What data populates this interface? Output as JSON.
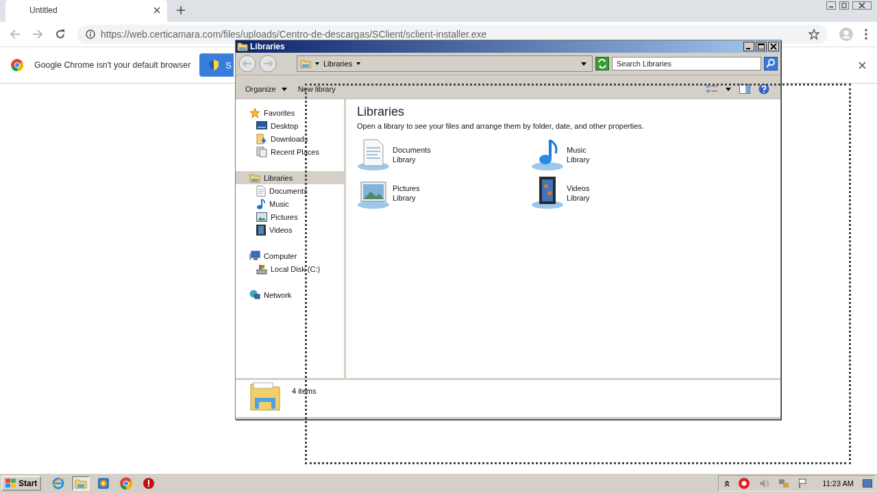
{
  "browser": {
    "tab": {
      "title": "Untitled"
    },
    "url": "https://web.certicamara.com/files/uploads/Centro-de-descargas/SClient/sclient-installer.exe",
    "infobar": {
      "message": "Google Chrome isn't your default browser",
      "button": "S"
    }
  },
  "explorer": {
    "title": "Libraries",
    "breadcrumb": "Libraries",
    "search": {
      "placeholder": "Search Libraries"
    },
    "toolbar": [
      {
        "label": "Organize",
        "menu": true
      },
      {
        "label": "New library",
        "menu": false
      }
    ],
    "nav": [
      {
        "label": "Favorites",
        "kind": "star",
        "selected": false,
        "children": [
          {
            "label": "Desktop",
            "kind": "desktop",
            "selected": false
          },
          {
            "label": "Downloads",
            "kind": "downloads",
            "selected": false
          },
          {
            "label": "Recent Places",
            "kind": "recent",
            "selected": false
          }
        ]
      },
      {
        "label": "Libraries",
        "kind": "library",
        "selected": true,
        "children": [
          {
            "label": "Documents",
            "kind": "documents",
            "selected": false
          },
          {
            "label": "Music",
            "kind": "music",
            "selected": false
          },
          {
            "label": "Pictures",
            "kind": "pictures",
            "selected": false
          },
          {
            "label": "Videos",
            "kind": "videos",
            "selected": false
          }
        ]
      },
      {
        "label": "Computer",
        "kind": "computer",
        "selected": false,
        "children": [
          {
            "label": "Local Disk (C:)",
            "kind": "disk",
            "selected": false
          }
        ]
      },
      {
        "label": "Network",
        "kind": "network",
        "selected": false
      }
    ],
    "heading": "Libraries",
    "description": "Open a library to see your files and arrange them by folder, date, and other properties.",
    "libraries": [
      {
        "name": "Documents",
        "type": "Library",
        "kind": "documents"
      },
      {
        "name": "Music",
        "type": "Library",
        "kind": "music"
      },
      {
        "name": "Pictures",
        "type": "Library",
        "kind": "pictures"
      },
      {
        "name": "Videos",
        "type": "Library",
        "kind": "videos"
      }
    ],
    "status": "4 items"
  },
  "taskbar": {
    "start": "Start",
    "apps": [
      {
        "kind": "ie",
        "selected": false
      },
      {
        "kind": "explorer",
        "selected": true
      },
      {
        "kind": "media",
        "selected": false
      },
      {
        "kind": "chrome",
        "selected": false
      },
      {
        "kind": "stop",
        "selected": false
      }
    ],
    "clock": "11:23 AM"
  }
}
